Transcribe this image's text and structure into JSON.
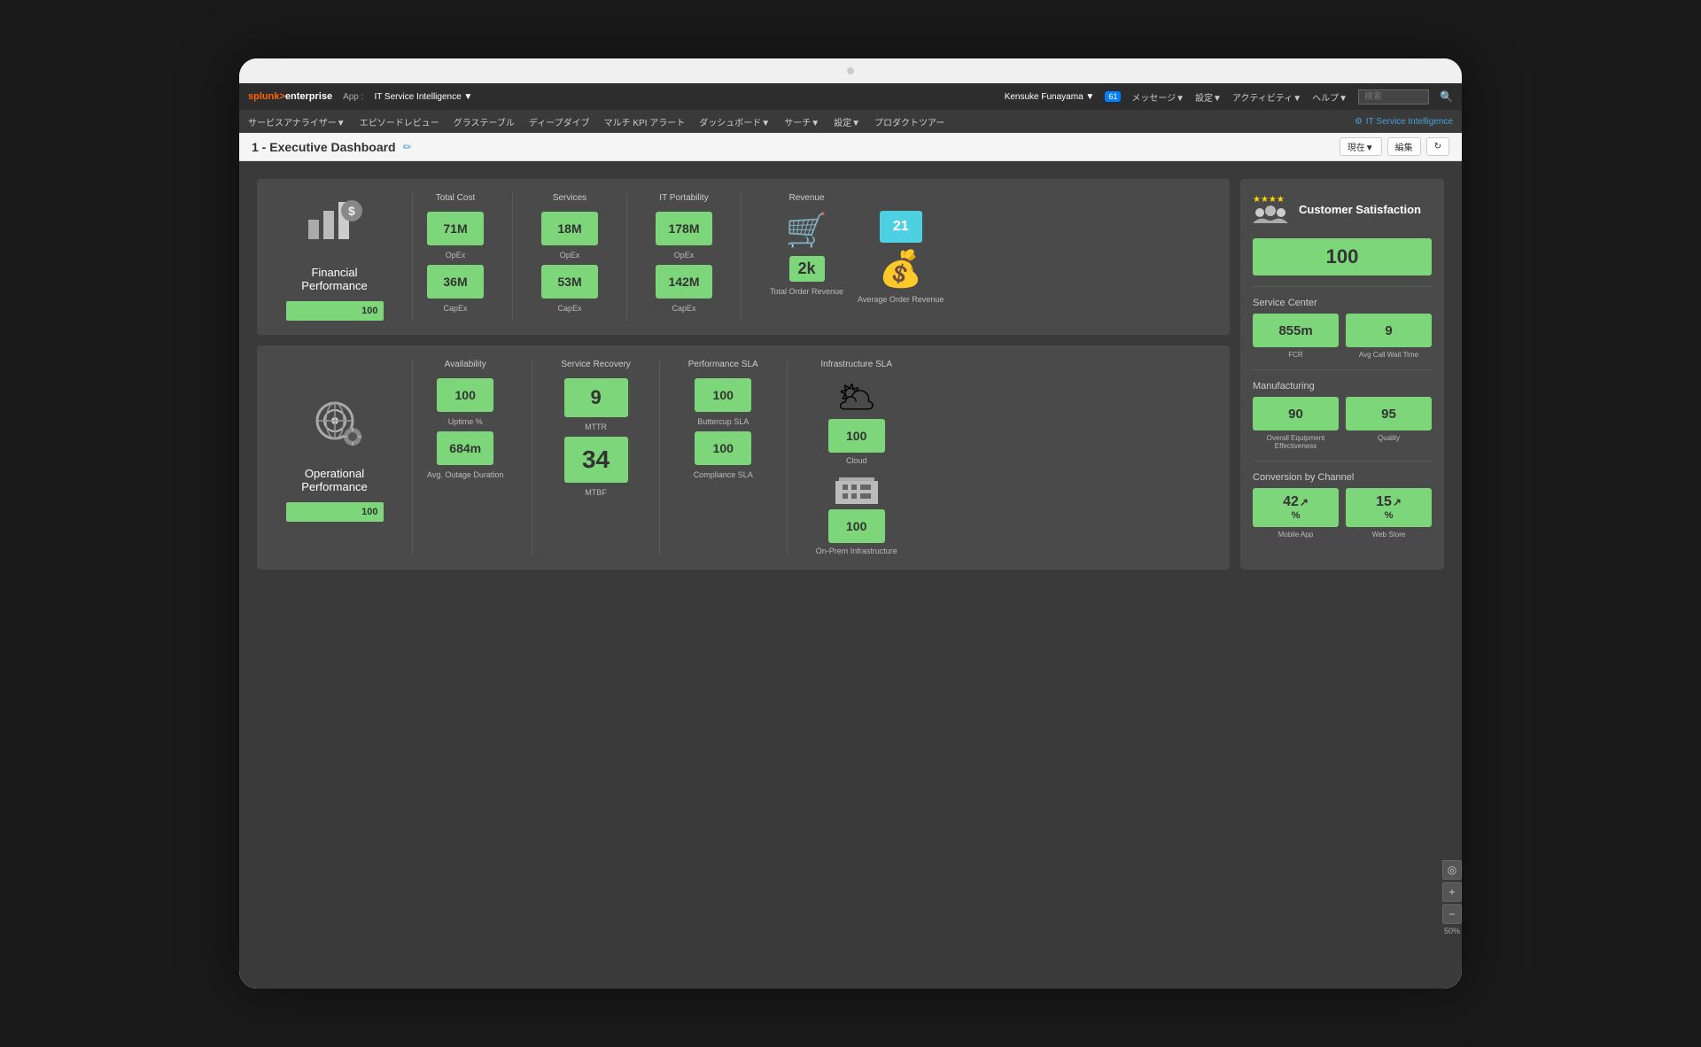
{
  "app": {
    "title": "splunk>enterprise",
    "app_label": "App :",
    "app_name": "IT Service Intelligence ▼",
    "user": "Kensuke Funayama ▼",
    "messages_badge": "61",
    "messages": "メッセージ▼",
    "settings": "設定▼",
    "activity": "アクティビティ▼",
    "help": "ヘルプ▼",
    "search_placeholder": "検索",
    "logo_right": "IT Service Intelligence"
  },
  "second_nav": {
    "items": [
      "サービスアナライザー▼",
      "エピソードレビュー",
      "グラステーブル",
      "ディープダイブ",
      "マルチ KPI アラート",
      "ダッシュボード▼",
      "サーチ▼",
      "設定▼",
      "プロダクトツアー"
    ]
  },
  "dashboard": {
    "title": "1 - Executive Dashboard",
    "now_btn": "現在▼",
    "edit_btn": "編集",
    "financial_performance": {
      "title": "Financial\nPerformance",
      "score": "100",
      "total_cost_title": "Total Cost",
      "services_title": "Services",
      "it_portability_title": "IT Portability",
      "revenue_title": "Revenue",
      "metrics": [
        {
          "value": "71M",
          "label": "OpEx"
        },
        {
          "value": "36M",
          "label": "CapEx"
        },
        {
          "value": "18M",
          "label": "OpEx"
        },
        {
          "value": "53M",
          "label": "CapEx"
        },
        {
          "value": "178M",
          "label": "OpEx"
        },
        {
          "value": "142M",
          "label": "CapEx"
        }
      ],
      "revenue_value": "2k",
      "total_order_label": "Total Order Revenue",
      "order_number": "21",
      "avg_order_label": "Average Order Revenue"
    },
    "operational_performance": {
      "title": "Operational\nPerformance",
      "score": "100",
      "availability_title": "Availability",
      "service_recovery_title": "Service Recovery",
      "performance_sla_title": "Performance SLA",
      "infra_sla_title": "Infrastructure SLA",
      "metrics": [
        {
          "value": "100",
          "label": "Uptime %"
        },
        {
          "value": "684m",
          "label": "Avg. Outage Duration"
        },
        {
          "value": "9",
          "label": "MTTR"
        },
        {
          "value": "34",
          "label": "MTBF"
        },
        {
          "value": "100",
          "label": "Buttercup SLA"
        },
        {
          "value": "100",
          "label": "Compliance SLA"
        }
      ],
      "cloud_value": "100",
      "cloud_label": "Cloud",
      "infra_value": "100",
      "infra_label": "On-Prem Infrastructure"
    },
    "customer_satisfaction": {
      "title": "Customer\nSatisfaction",
      "score": "100",
      "service_center_title": "Service Center",
      "fcr_value": "855m",
      "fcr_label": "FCR",
      "avg_call_value": "9",
      "avg_call_label": "Avg Call Wait Time",
      "manufacturing_title": "Manufacturing",
      "effectiveness_value": "90",
      "effectiveness_label": "Overall Equipment\nEffectiveness",
      "quality_value": "95",
      "quality_label": "Quality",
      "conversion_title": "Conversion by Channel",
      "mobile_value": "42",
      "mobile_arrow": "↗",
      "mobile_pct": "%",
      "mobile_label": "Mobile App",
      "web_value": "15",
      "web_arrow": "↗",
      "web_pct": "%",
      "web_label": "Web Store"
    }
  },
  "zoom": "50%"
}
